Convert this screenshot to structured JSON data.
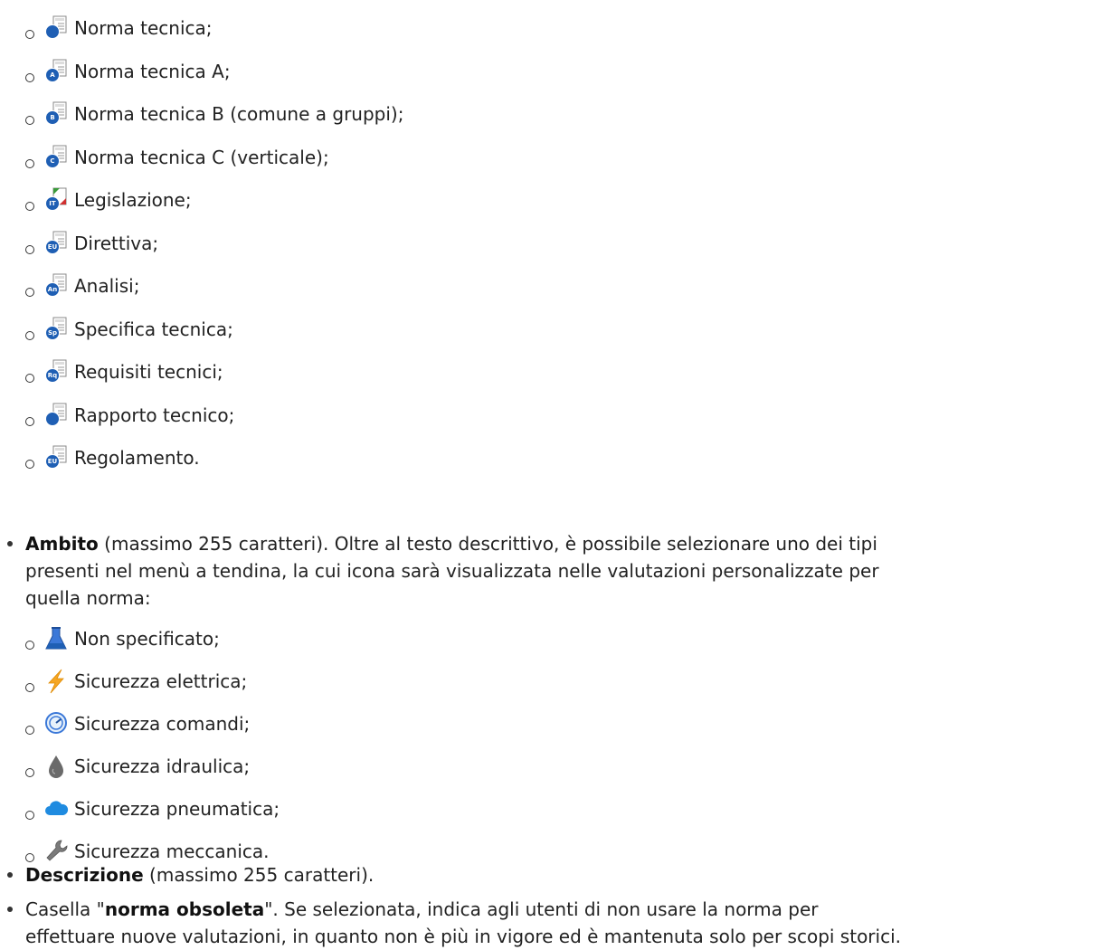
{
  "types_list": [
    {
      "label": "Norma tecnica;",
      "icon": "norm-icon"
    },
    {
      "label": "Norma tecnica A;",
      "icon": "norm-a-icon"
    },
    {
      "label": "Norma tecnica B (comune a gruppi);",
      "icon": "norm-b-icon"
    },
    {
      "label": "Norma tecnica C (verticale);",
      "icon": "norm-c-icon"
    },
    {
      "label": "Legislazione;",
      "icon": "legislation-icon"
    },
    {
      "label": "Direttiva;",
      "icon": "directive-icon"
    },
    {
      "label": "Analisi;",
      "icon": "analysis-icon"
    },
    {
      "label": "Specifica tecnica;",
      "icon": "technical-spec-icon"
    },
    {
      "label": "Requisiti tecnici;",
      "icon": "technical-requirements-icon"
    },
    {
      "label": "Rapporto tecnico;",
      "icon": "technical-report-icon"
    },
    {
      "label": "Regolamento.",
      "icon": "regulation-icon"
    }
  ],
  "ambito": {
    "term": "Ambito",
    "text_line1": " (massimo 255 caratteri). Oltre al testo descrittivo, è possibile selezionare uno dei tipi",
    "text_line2": "presenti nel menù a tendina, la cui icona sarà visualizzata nelle valutazioni personalizzate per",
    "text_line3": "quella norma:"
  },
  "scope_list": [
    {
      "label": "Non specificato;",
      "icon": "flask-icon"
    },
    {
      "label": "Sicurezza elettrica;",
      "icon": "lightning-icon"
    },
    {
      "label": "Sicurezza comandi;",
      "icon": "gauge-icon"
    },
    {
      "label": "Sicurezza idraulica;",
      "icon": "water-drop-icon"
    },
    {
      "label": "Sicurezza pneumatica;",
      "icon": "cloud-icon"
    },
    {
      "label": "Sicurezza meccanica.",
      "icon": "wrench-icon"
    }
  ],
  "descrizione": {
    "term": "Descrizione",
    "text": " (massimo 255 caratteri)."
  },
  "obsoleta": {
    "prefix": "Casella \"",
    "term": "norma obsoleta",
    "suffix_line1": "\". Se selezionata, indica agli utenti di non usare la norma per",
    "line2": "effettuare nuove valutazioni, in quanto non è più in vigore ed è mantenuta solo per scopi storici."
  },
  "colors": {
    "doc_blue": "#1f5fb4",
    "doc_green": "#3a9a3a",
    "doc_red": "#d03030",
    "bolt_orange": "#f5a623",
    "gray": "#6a6a6a"
  }
}
